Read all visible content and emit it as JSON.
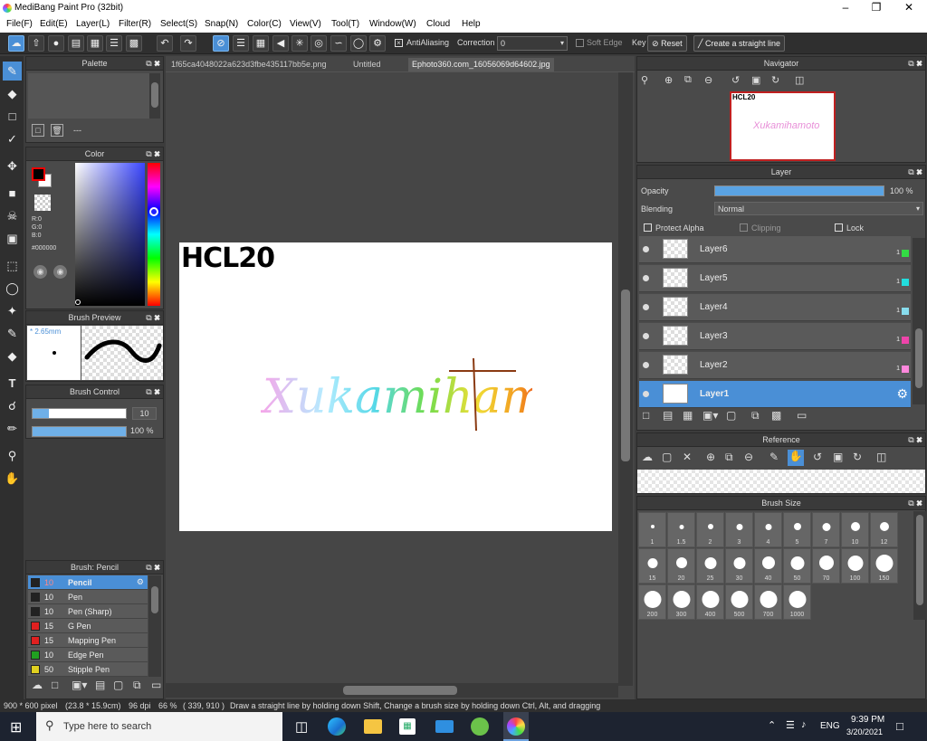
{
  "app": {
    "title": "MediBang Paint Pro (32bit)"
  },
  "menu": [
    "File(F)",
    "Edit(E)",
    "Layer(L)",
    "Filter(R)",
    "Select(S)",
    "Snap(N)",
    "Color(C)",
    "View(V)",
    "Tool(T)",
    "Window(W)",
    "Cloud",
    "Help"
  ],
  "toolbar": {
    "antialiasing": "AntiAliasing",
    "correction_label": "Correction",
    "correction_value": "0",
    "soft_edge": "Soft Edge",
    "key_label": "Key",
    "reset": "Reset",
    "straight_line": "Create a straight line"
  },
  "palette": {
    "title": "Palette",
    "dash": "---"
  },
  "color": {
    "title": "Color",
    "r": "R:0",
    "g": "G:0",
    "b": "B:0",
    "hex": "#000000",
    "fg": "#000000",
    "bg": "#ffffff"
  },
  "brush_preview": {
    "title": "Brush Preview",
    "size": "* 2.65mm"
  },
  "brush_control": {
    "title": "Brush Control",
    "size_value": "10",
    "opacity_value": "100 %"
  },
  "brush_list": {
    "title": "Brush: Pencil",
    "items": [
      {
        "size": "10",
        "name": "Pencil",
        "color": "#222222"
      },
      {
        "size": "10",
        "name": "Pen",
        "color": "#222222"
      },
      {
        "size": "10",
        "name": "Pen (Sharp)",
        "color": "#222222"
      },
      {
        "size": "15",
        "name": "G Pen",
        "color": "#e02020"
      },
      {
        "size": "15",
        "name": "Mapping Pen",
        "color": "#e02020"
      },
      {
        "size": "10",
        "name": "Edge Pen",
        "color": "#20a020"
      },
      {
        "size": "50",
        "name": "Stipple Pen",
        "color": "#e0d020"
      }
    ]
  },
  "tabs": [
    "1f65ca4048022a623d3fbe435117bb5e.png",
    "Untitled",
    "Ephoto360.com_16056069d64602.jpg"
  ],
  "canvas_text": {
    "title": "HCL20",
    "name": "Xukamihamoto"
  },
  "navigator": {
    "title": "Navigator",
    "preview_title": "HCL20",
    "preview_name": "Xukamihamoto"
  },
  "layer": {
    "title": "Layer",
    "opacity_label": "Opacity",
    "opacity_value": "100 %",
    "opacity": 1.0,
    "blending_label": "Blending",
    "blending_value": "Normal",
    "protect_alpha": "Protect Alpha",
    "clipping": "Clipping",
    "lock": "Lock",
    "layers": [
      {
        "name": "Layer6",
        "color": "#33dd44",
        "num": "1"
      },
      {
        "name": "Layer5",
        "color": "#22dddd",
        "num": "1"
      },
      {
        "name": "Layer4",
        "color": "#88ddee",
        "num": "1"
      },
      {
        "name": "Layer3",
        "color": "#ee44aa",
        "num": "1"
      },
      {
        "name": "Layer2",
        "color": "#ff88dd",
        "num": "1"
      },
      {
        "name": "Layer1",
        "color": "",
        "num": ""
      }
    ]
  },
  "reference": {
    "title": "Reference"
  },
  "brush_size": {
    "title": "Brush Size",
    "sizes": [
      "1",
      "1.5",
      "2",
      "3",
      "4",
      "5",
      "7",
      "10",
      "12",
      "15",
      "20",
      "25",
      "30",
      "40",
      "50",
      "70",
      "100",
      "150",
      "200",
      "300",
      "400",
      "500",
      "700",
      "1000"
    ]
  },
  "status": {
    "size": "900 * 600 pixel",
    "cm": "(23.8 * 15.9cm)",
    "dpi": "96 dpi",
    "zoom": "66 %",
    "coords": "( 339, 910 )",
    "hint": "Draw a straight line by holding down Shift, Change a brush size by holding down Ctrl, Alt, and dragging"
  },
  "taskbar": {
    "search_placeholder": "Type here to search",
    "lang": "ENG",
    "time": "9:39 PM",
    "date": "3/20/2021"
  }
}
